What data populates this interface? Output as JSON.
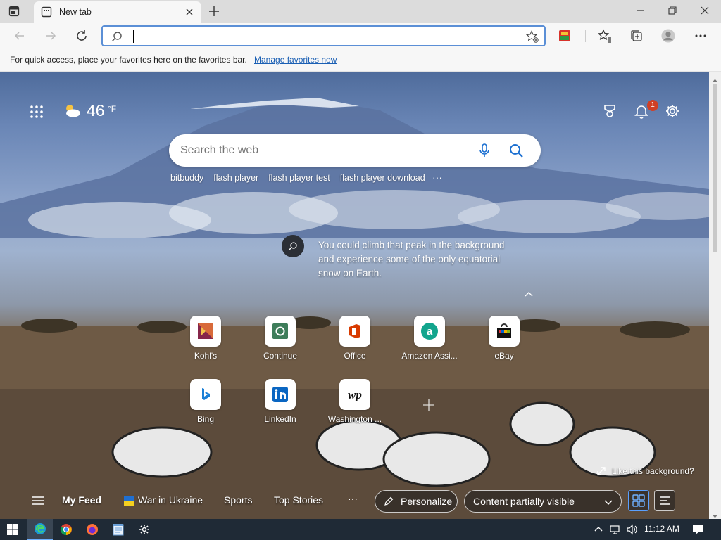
{
  "browser": {
    "tab_title": "New tab",
    "address_value": "",
    "favorites_bar_text": "For quick access, place your favorites here on the favorites bar.",
    "favorites_bar_link": "Manage favorites now"
  },
  "ntp": {
    "temperature": "46",
    "temp_unit": "°F",
    "notification_count": "1",
    "search_placeholder": "Search the web",
    "suggestions": [
      "bitbuddy",
      "flash player",
      "flash player test",
      "flash player download"
    ],
    "suggestions_more": "···",
    "fact_text": "You could climb that peak in the background and experience some of the only equatorial snow on Earth.",
    "quick_links": [
      {
        "label": "Kohl's",
        "icon": "kohls-icon"
      },
      {
        "label": "Continue",
        "icon": "continue-icon"
      },
      {
        "label": "Office",
        "icon": "office-icon"
      },
      {
        "label": "Amazon Assi...",
        "icon": "amazon-assistant-icon"
      },
      {
        "label": "eBay",
        "icon": "ebay-icon"
      },
      {
        "label": "Bing",
        "icon": "bing-icon"
      },
      {
        "label": "LinkedIn",
        "icon": "linkedin-icon"
      },
      {
        "label": "Washington ...",
        "icon": "washington-post-icon"
      }
    ],
    "like_background": "Like this background?",
    "feed": {
      "my_feed": "My Feed",
      "items": [
        "War in Ukraine",
        "Sports",
        "Top Stories"
      ],
      "more": "···",
      "personalize": "Personalize",
      "content_visibility": "Content partially visible"
    }
  },
  "taskbar": {
    "clock": "11:12 AM"
  },
  "colors": {
    "accent": "#5b8fd6",
    "badge": "#d13f25",
    "taskbar": "#1f2a36"
  }
}
